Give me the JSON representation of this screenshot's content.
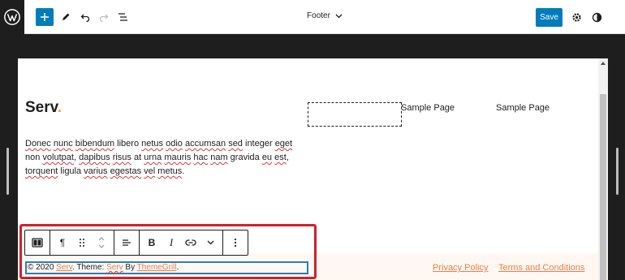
{
  "header": {
    "document_title": "Footer",
    "save_label": "Save",
    "icons": [
      "wordpress-logo",
      "plus-icon",
      "pencil-icon",
      "undo-icon",
      "redo-icon",
      "list-view-icon",
      "chevron-down-icon",
      "gear-icon",
      "contrast-icon"
    ]
  },
  "canvas": {
    "site_title": "Serv",
    "site_title_dot": ".",
    "nav": [
      "Sample Page",
      "Sample Page"
    ],
    "paragraph": {
      "parts": [
        {
          "t": "Donec",
          "sp": true
        },
        {
          "t": " "
        },
        {
          "t": "nunc",
          "sp": true
        },
        {
          "t": " "
        },
        {
          "t": "bibendum",
          "sp": true
        },
        {
          "t": " libero "
        },
        {
          "t": "netus",
          "sp": true
        },
        {
          "t": " "
        },
        {
          "t": "odio",
          "sp": true
        },
        {
          "t": " "
        },
        {
          "t": "accumsan",
          "sp": true
        },
        {
          "t": " "
        },
        {
          "t": "sed",
          "sp": true
        },
        {
          "t": " integer "
        },
        {
          "t": "eget",
          "sp": true
        },
        {
          "t": " non "
        },
        {
          "t": "volutpat",
          "sp": true
        },
        {
          "t": ", "
        },
        {
          "t": "dapibus",
          "sp": true
        },
        {
          "t": " "
        },
        {
          "t": "risus",
          "sp": true
        },
        {
          "t": " at "
        },
        {
          "t": "urna",
          "sp": true
        },
        {
          "t": " "
        },
        {
          "t": "mauris",
          "sp": true
        },
        {
          "t": " "
        },
        {
          "t": "hac",
          "sp": true
        },
        {
          "t": " "
        },
        {
          "t": "nam",
          "sp": true
        },
        {
          "t": " gravida "
        },
        {
          "t": "eu",
          "sp": true
        },
        {
          "t": " "
        },
        {
          "t": "est",
          "sp": true
        },
        {
          "t": ", "
        },
        {
          "t": "torquent",
          "sp": true
        },
        {
          "t": " ligula "
        },
        {
          "t": "varius",
          "sp": true
        },
        {
          "t": " "
        },
        {
          "t": "egestas",
          "sp": true
        },
        {
          "t": " "
        },
        {
          "t": "vel",
          "sp": true
        },
        {
          "t": " "
        },
        {
          "t": "metus",
          "sp": true
        },
        {
          "t": "."
        }
      ]
    },
    "footer": {
      "copyright_prefix": "© 2020 ",
      "site_link": "Serv",
      "theme_text": ". Theme: ",
      "theme_link": "Serv",
      "by_text": " By ",
      "author_link": "ThemeGrill",
      "end": ".",
      "links": [
        "Privacy Policy",
        "Terms and Conditions"
      ]
    }
  },
  "block_toolbar": {
    "groups": [
      [
        "columns-icon"
      ],
      [
        "paragraph-icon",
        "drag-handle-icon",
        "move-arrows-icon"
      ],
      [
        "align-left-icon"
      ],
      [
        "bold-icon",
        "italic-icon",
        "link-icon",
        "chevron-down-icon"
      ],
      [
        "more-options-icon"
      ]
    ],
    "labels": {
      "bold": "B",
      "italic": "I",
      "paragraph": "¶"
    }
  },
  "colors": {
    "accent": "#007cba",
    "highlight": "#d0212a",
    "link": "#e87f4b",
    "footer_bg": "#fff7f2"
  }
}
